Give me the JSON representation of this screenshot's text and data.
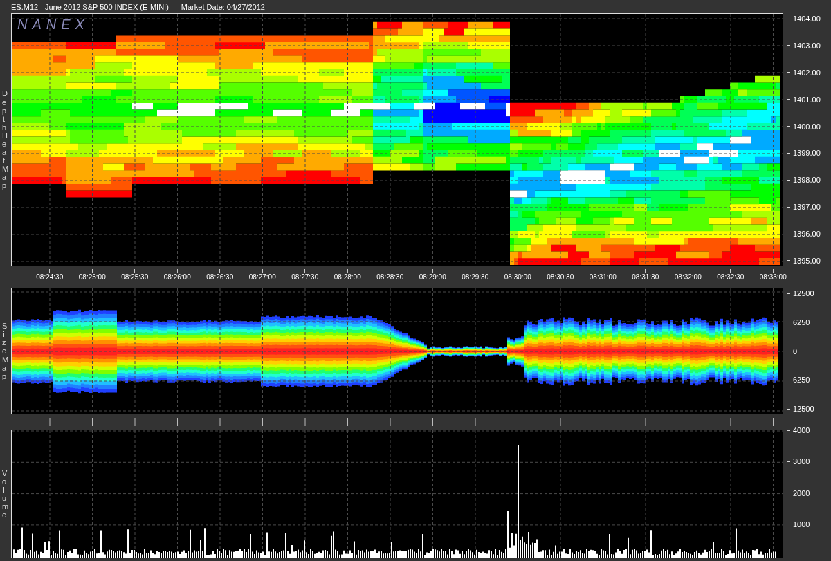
{
  "title": "ES.M12 - June 2012 S&P 500 INDEX (E-MINI)",
  "market_date": "Market Date: 04/27/2012",
  "depth_heat_map": {
    "label": "Depth Heat Map",
    "logo": "NANEX",
    "y_ticks": [
      "1404.00",
      "1403.00",
      "1402.00",
      "1401.00",
      "1400.00",
      "1399.00",
      "1398.00",
      "1397.00",
      "1396.00",
      "1395.00"
    ]
  },
  "time_axis": [
    "08:24:30",
    "08:25:00",
    "08:25:30",
    "08:26:00",
    "08:26:30",
    "08:27:00",
    "08:27:30",
    "08:28:00",
    "08:28:30",
    "08:29:00",
    "08:29:30",
    "08:30:00",
    "08:30:30",
    "08:31:00",
    "08:31:30",
    "08:32:00",
    "08:32:30",
    "08:33:00"
  ],
  "size_map": {
    "label": "Size Map",
    "y_ticks": [
      "12500",
      "6250",
      "0",
      "6250",
      "12500"
    ]
  },
  "volume": {
    "label": "Volume",
    "y_ticks": [
      "4000",
      "3000",
      "2000",
      "1000"
    ]
  }
}
